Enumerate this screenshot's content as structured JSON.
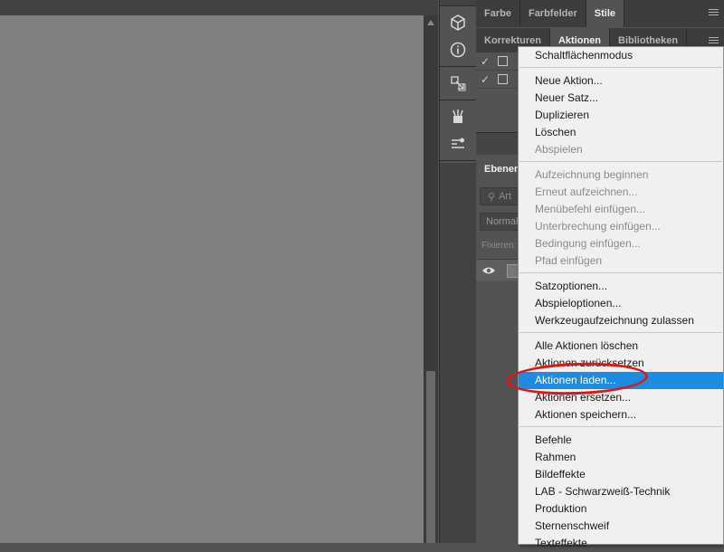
{
  "top_tabs": [
    {
      "label": "Farbe"
    },
    {
      "label": "Farbfelder"
    },
    {
      "label": "Stile"
    }
  ],
  "second_tabs": [
    {
      "label": "Korrekturen"
    },
    {
      "label": "Aktionen"
    },
    {
      "label": "Bibliotheken"
    }
  ],
  "layers_panel": {
    "tab": "Ebenen",
    "search_placeholder": "Art",
    "blend_mode": "Normal",
    "lock_label": "Fixieren:"
  },
  "menu": {
    "items": [
      {
        "label": "Schaltflächenmodus",
        "state": "enabled"
      },
      {
        "label": "Neue Aktion...",
        "state": "enabled"
      },
      {
        "label": "Neuer Satz...",
        "state": "enabled"
      },
      {
        "label": "Duplizieren",
        "state": "enabled"
      },
      {
        "label": "Löschen",
        "state": "enabled"
      },
      {
        "label": "Abspielen",
        "state": "disabled"
      },
      {
        "label": "Aufzeichnung beginnen",
        "state": "disabled"
      },
      {
        "label": "Erneut aufzeichnen...",
        "state": "disabled"
      },
      {
        "label": "Menübefehl einfügen...",
        "state": "disabled"
      },
      {
        "label": "Unterbrechung einfügen...",
        "state": "disabled"
      },
      {
        "label": "Bedingung einfügen...",
        "state": "disabled"
      },
      {
        "label": "Pfad einfügen",
        "state": "disabled"
      },
      {
        "label": "Satzoptionen...",
        "state": "enabled"
      },
      {
        "label": "Abspieloptionen...",
        "state": "enabled"
      },
      {
        "label": "Werkzeugaufzeichnung zulassen",
        "state": "enabled"
      },
      {
        "label": "Alle Aktionen löschen",
        "state": "enabled"
      },
      {
        "label": "Aktionen zurücksetzen",
        "state": "enabled"
      },
      {
        "label": "Aktionen laden...",
        "state": "highlighted"
      },
      {
        "label": "Aktionen ersetzen...",
        "state": "enabled"
      },
      {
        "label": "Aktionen speichern...",
        "state": "enabled"
      },
      {
        "label": "Befehle",
        "state": "enabled"
      },
      {
        "label": "Rahmen",
        "state": "enabled"
      },
      {
        "label": "Bildeffekte",
        "state": "enabled"
      },
      {
        "label": "LAB - Schwarzweiß-Technik",
        "state": "enabled"
      },
      {
        "label": "Produktion",
        "state": "enabled"
      },
      {
        "label": "Sternenschweif",
        "state": "enabled"
      },
      {
        "label": "Texteffekte",
        "state": "enabled"
      }
    ]
  },
  "colors": {
    "highlight": "#1d8ce0",
    "annotation_circle": "#e01616"
  },
  "icons": {
    "tool_icons": [
      "3d-box-icon",
      "info-icon",
      "path-selection-icon",
      "brushes-icon",
      "brush-settings-icon"
    ]
  }
}
